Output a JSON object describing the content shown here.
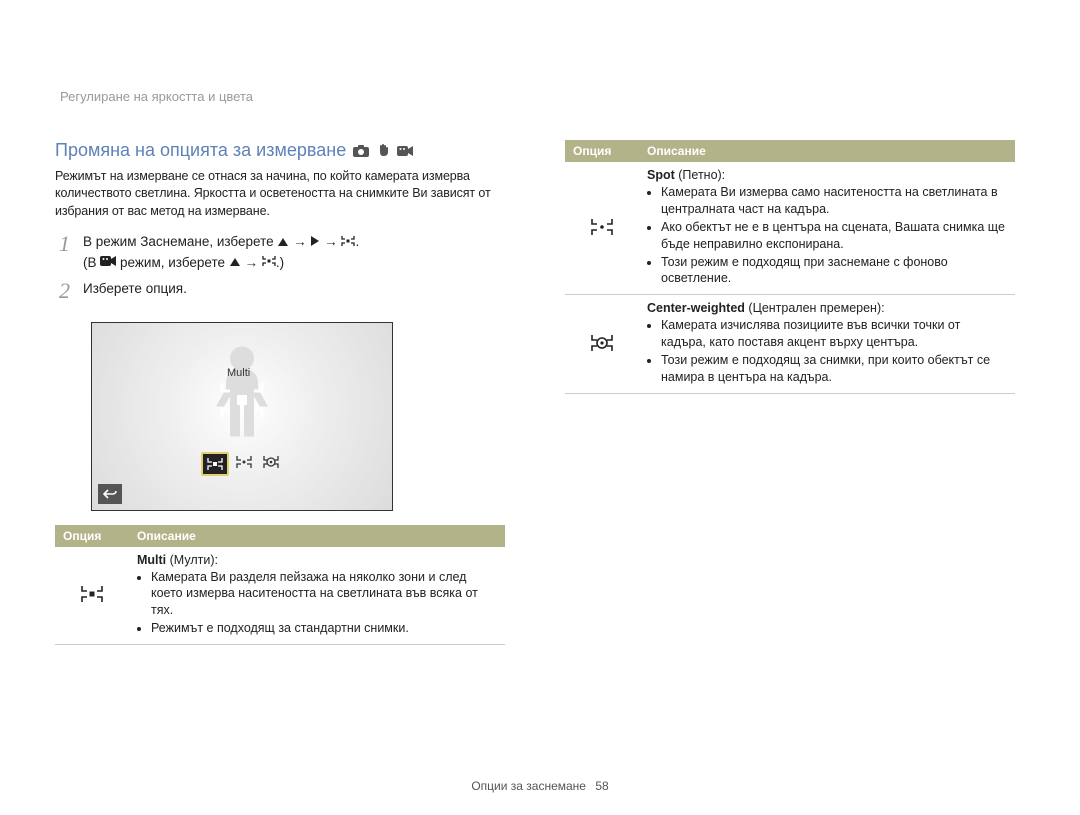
{
  "section_header": "Регулиране на яркостта и цвета",
  "heading": "Промяна на опцията за измерване",
  "intro": "Режимът на измерване се отнася за начина, по който камерата измерва количеството светлина. Яркостта и осветеността на снимките Ви зависят от избрания от вас метод на измерване.",
  "step1_a": "В режим Заснемане, изберете",
  "step1_b": "(В",
  "step1_c": "режим, изберете",
  "step2": "Изберете опция.",
  "fig_label": "Multi",
  "th_option": "Опция",
  "th_desc": "Описание",
  "row_multi": {
    "title_strong": "Multi",
    "title_rest": " (Мулти):",
    "b1": "Камерата Ви разделя пейзажа на няколко зони и след което измерва наситеността на светлината във всяка от тях.",
    "b2": "Режимът е подходящ за стандартни снимки."
  },
  "row_spot": {
    "title_strong": "Spot",
    "title_rest": " (Петно):",
    "b1": "Камерата Ви измерва само наситеността на светлината в централната част на кадъра.",
    "b2": "Ако обектът не е в центъра на сцената, Вашата снимка ще бъде неправилно експонирана.",
    "b3": "Този режим е подходящ при заснемане с фоново осветление."
  },
  "row_center": {
    "title_strong": "Center-weighted",
    "title_rest": " (Централен премерен):",
    "b1": "Камерата изчислява позициите във всички точки от кадъра, като поставя акцент върху центъра.",
    "b2": "Този режим е подходящ за снимки, при които обектът се намира в центъра на кадъра."
  },
  "footer_label": "Опции за заснемане",
  "footer_page": "58"
}
